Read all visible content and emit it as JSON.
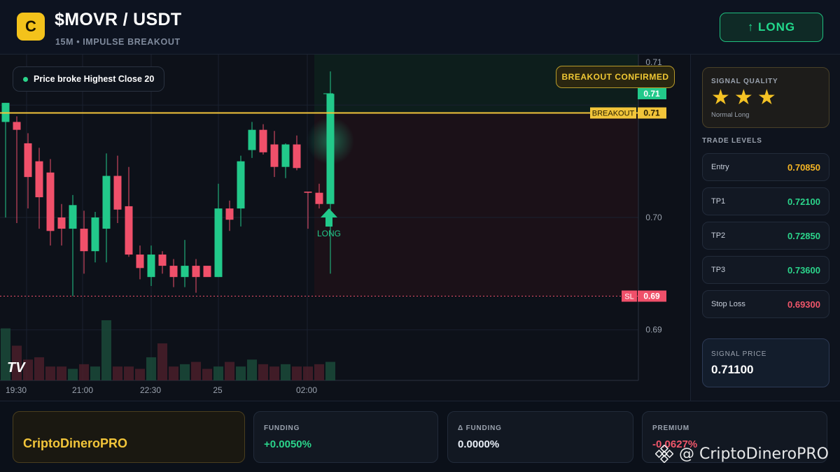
{
  "header": {
    "logo_letter": "C",
    "pair": "$MOVR / USDT",
    "subtitle": "15M • IMPULSE BREAKOUT",
    "signal_button": "↑ LONG"
  },
  "chart_overlay": {
    "chip_text": "Price broke Highest Close 20",
    "confirmed_badge": "BREAKOUT CONFIRMED",
    "breakout_label": "BREAKOUT",
    "breakout_value": "0.71",
    "last_price_label": "0.71",
    "sl_label": "SL",
    "sl_value": "0.69",
    "long_marker": "LONG",
    "tv_logo": "TV"
  },
  "chart_data": {
    "type": "candlestick",
    "y_ticks": [
      "0.71",
      "0.70",
      "0.69"
    ],
    "x_ticks": [
      "19:30",
      "21:00",
      "22:30",
      "25",
      "02:00"
    ],
    "ylim": [
      0.6855,
      0.7145
    ],
    "breakout_level": 0.7093,
    "stop_loss_level": 0.693,
    "grid": true,
    "candles": [
      {
        "o": 0.7085,
        "h": 0.7102,
        "l": 0.7,
        "c": 0.7102
      },
      {
        "o": 0.7085,
        "h": 0.709,
        "l": 0.6995,
        "c": 0.7078
      },
      {
        "o": 0.7066,
        "h": 0.7075,
        "l": 0.7008,
        "c": 0.7036
      },
      {
        "o": 0.705,
        "h": 0.7062,
        "l": 0.699,
        "c": 0.7018
      },
      {
        "o": 0.704,
        "h": 0.7052,
        "l": 0.6975,
        "c": 0.6988
      },
      {
        "o": 0.7,
        "h": 0.7012,
        "l": 0.6975,
        "c": 0.699
      },
      {
        "o": 0.699,
        "h": 0.702,
        "l": 0.693,
        "c": 0.7011
      },
      {
        "o": 0.699,
        "h": 0.7006,
        "l": 0.695,
        "c": 0.697
      },
      {
        "o": 0.697,
        "h": 0.7005,
        "l": 0.696,
        "c": 0.7
      },
      {
        "o": 0.699,
        "h": 0.7057,
        "l": 0.696,
        "c": 0.7037
      },
      {
        "o": 0.7037,
        "h": 0.7055,
        "l": 0.6995,
        "c": 0.7007
      },
      {
        "o": 0.701,
        "h": 0.7045,
        "l": 0.6965,
        "c": 0.6967
      },
      {
        "o": 0.6967,
        "h": 0.6975,
        "l": 0.6945,
        "c": 0.6955
      },
      {
        "o": 0.6947,
        "h": 0.6975,
        "l": 0.6939,
        "c": 0.6967
      },
      {
        "o": 0.6967,
        "h": 0.697,
        "l": 0.695,
        "c": 0.6957
      },
      {
        "o": 0.6957,
        "h": 0.6963,
        "l": 0.6938,
        "c": 0.6947
      },
      {
        "o": 0.6947,
        "h": 0.698,
        "l": 0.6938,
        "c": 0.6957
      },
      {
        "o": 0.6957,
        "h": 0.6963,
        "l": 0.6933,
        "c": 0.6947
      },
      {
        "o": 0.6957,
        "h": 0.6945,
        "l": 0.6945,
        "c": 0.6947
      },
      {
        "o": 0.6947,
        "h": 0.703,
        "l": 0.6947,
        "c": 0.7008
      },
      {
        "o": 0.7008,
        "h": 0.7015,
        "l": 0.6988,
        "c": 0.6998
      },
      {
        "o": 0.7008,
        "h": 0.7055,
        "l": 0.6992,
        "c": 0.705
      },
      {
        "o": 0.706,
        "h": 0.7085,
        "l": 0.7053,
        "c": 0.7078
      },
      {
        "o": 0.7078,
        "h": 0.7083,
        "l": 0.7056,
        "c": 0.7058
      },
      {
        "o": 0.7065,
        "h": 0.7077,
        "l": 0.7036,
        "c": 0.7045
      },
      {
        "o": 0.7045,
        "h": 0.7066,
        "l": 0.7035,
        "c": 0.7065
      },
      {
        "o": 0.7065,
        "h": 0.7073,
        "l": 0.7042,
        "c": 0.7044
      },
      {
        "o": 0.7023,
        "h": 0.7023,
        "l": 0.699,
        "c": 0.7022
      },
      {
        "o": 0.7022,
        "h": 0.703,
        "l": 0.7008,
        "c": 0.7012
      },
      {
        "o": 0.7012,
        "h": 0.713,
        "l": 0.695,
        "c": 0.711
      }
    ],
    "volume": [
      45,
      30,
      18,
      20,
      12,
      12,
      10,
      14,
      12,
      52,
      12,
      12,
      10,
      20,
      32,
      12,
      14,
      16,
      10,
      12,
      16,
      12,
      18,
      14,
      12,
      14,
      12,
      12,
      14,
      16
    ]
  },
  "side": {
    "quality_title": "SIGNAL QUALITY",
    "stars": 3,
    "quality_note": "Normal Long",
    "levels_title": "TRADE LEVELS",
    "levels": [
      {
        "label": "Entry",
        "value": "0.70850",
        "color": "#f5b524"
      },
      {
        "label": "TP1",
        "value": "0.72100",
        "color": "#2bd48b"
      },
      {
        "label": "TP2",
        "value": "0.72850",
        "color": "#2bd48b"
      },
      {
        "label": "TP3",
        "value": "0.73600",
        "color": "#2bd48b"
      },
      {
        "label": "Stop Loss",
        "value": "0.69300",
        "color": "#f0566a"
      }
    ],
    "signal_price_title": "SIGNAL PRICE",
    "signal_price": "0.71100"
  },
  "bottom": {
    "brand": "CriptoDineroPRO",
    "funding_title": "FUNDING",
    "funding_value": "+0.0050%",
    "delta_title": "Δ FUNDING",
    "delta_value": "0.0000%",
    "premium_title": "PREMIUM",
    "premium_value": "-0.0627%",
    "watermark": "@ CriptoDineroPRO"
  },
  "colors": {
    "up": "#22c98a",
    "down": "#f0506a",
    "gold": "#f2c53a"
  }
}
